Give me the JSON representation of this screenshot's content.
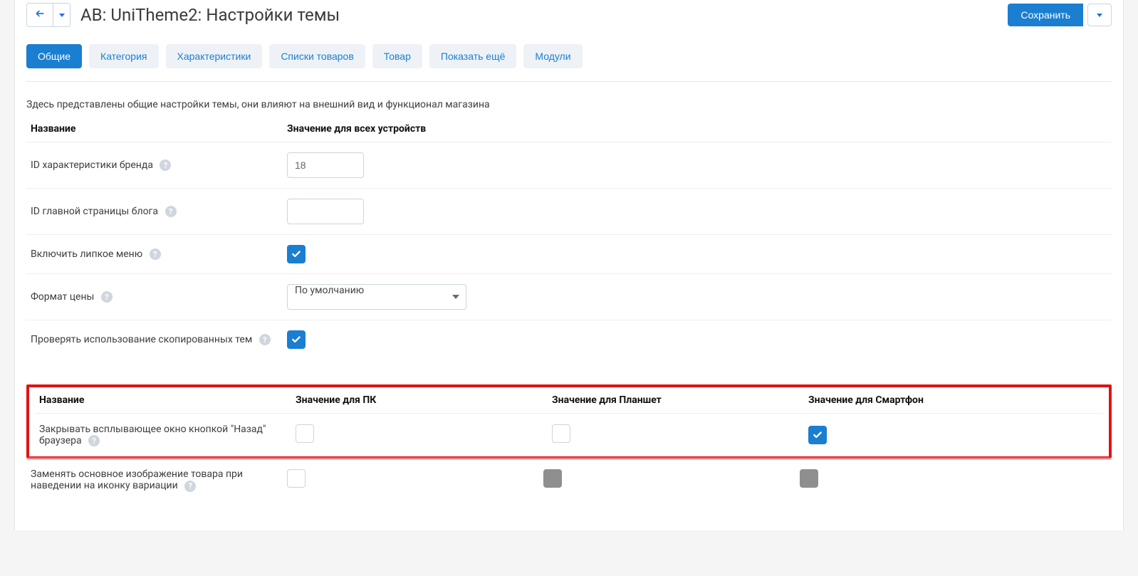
{
  "header": {
    "title": "AB: UniTheme2: Настройки темы",
    "save_label": "Сохранить"
  },
  "tabs": [
    {
      "label": "Общие",
      "active": true
    },
    {
      "label": "Категория",
      "active": false
    },
    {
      "label": "Характеристики",
      "active": false
    },
    {
      "label": "Списки товаров",
      "active": false
    },
    {
      "label": "Товар",
      "active": false
    },
    {
      "label": "Показать ещё",
      "active": false
    },
    {
      "label": "Модули",
      "active": false
    }
  ],
  "intro": "Здесь представлены общие настройки темы, они влияют на внешний вид и функционал магазина",
  "table_all": {
    "head_name": "Название",
    "head_value": "Значение для всех устройств",
    "rows": [
      {
        "label": "ID характеристики бренда",
        "type": "text",
        "value": "18",
        "help": true
      },
      {
        "label": "ID главной страницы блога",
        "type": "text",
        "value": "",
        "help": true
      },
      {
        "label": "Включить липкое меню",
        "type": "checkbox",
        "checked": true,
        "help": true
      },
      {
        "label": "Формат цены",
        "type": "select",
        "value": "По умолчанию",
        "help": true
      },
      {
        "label": "Проверять использование скопированных тем",
        "type": "checkbox",
        "checked": true,
        "help": true
      }
    ]
  },
  "table_devices": {
    "head_name": "Название",
    "head_pc": "Значение для ПК",
    "head_tablet": "Значение для Планшет",
    "head_phone": "Значение для Смартфон",
    "rows": [
      {
        "label": "Закрывать всплывающее окно кнопкой \"Назад\" браузера",
        "help": true,
        "pc": {
          "state": "unchecked"
        },
        "tablet": {
          "state": "unchecked"
        },
        "phone": {
          "state": "checked"
        }
      },
      {
        "label": "Заменять основное изображение товара при наведении на иконку вариации",
        "help": true,
        "pc": {
          "state": "unchecked"
        },
        "tablet": {
          "state": "disabled"
        },
        "phone": {
          "state": "disabled"
        }
      }
    ]
  }
}
